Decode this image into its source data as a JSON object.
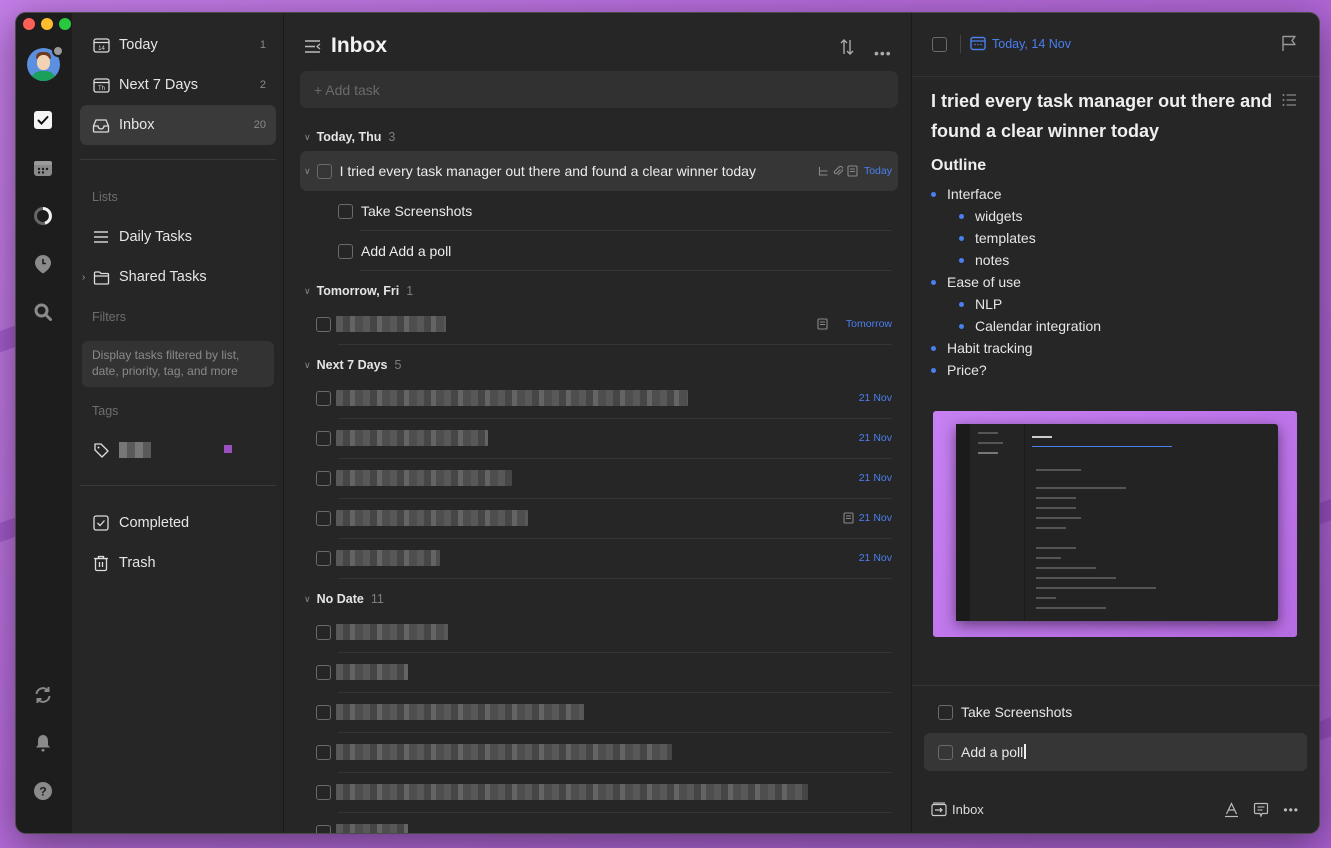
{
  "window": {
    "traffic_lights": [
      "close",
      "minimize",
      "zoom"
    ]
  },
  "rail": {
    "items": [
      {
        "name": "avatar",
        "icon": "user-avatar"
      },
      {
        "name": "tasks",
        "icon": "checkbox-icon",
        "active": true
      },
      {
        "name": "calendar",
        "icon": "calendar-icon"
      },
      {
        "name": "habit",
        "icon": "progress-ring-icon"
      },
      {
        "name": "pomodoro",
        "icon": "clock-pin-icon"
      },
      {
        "name": "search",
        "icon": "search-icon"
      },
      {
        "name": "sync",
        "icon": "sync-icon"
      },
      {
        "name": "notifications",
        "icon": "bell-icon"
      },
      {
        "name": "help",
        "icon": "help-icon"
      }
    ]
  },
  "sidebar": {
    "smart_lists": [
      {
        "label": "Today",
        "count": "1",
        "icon": "calendar-14-icon"
      },
      {
        "label": "Next 7 Days",
        "count": "2",
        "icon": "calendar-week-icon"
      },
      {
        "label": "Inbox",
        "count": "20",
        "icon": "inbox-icon",
        "active": true
      }
    ],
    "lists_header": "Lists",
    "lists": [
      {
        "label": "Daily Tasks",
        "icon": "list-icon"
      },
      {
        "label": "Shared Tasks",
        "icon": "folder-icon",
        "expandable": true
      }
    ],
    "filters_header": "Filters",
    "filters_hint": "Display tasks filtered by list, date, priority, tag, and more",
    "tags_header": "Tags",
    "tags": [
      {
        "label": "[redacted]",
        "color": "#9b4fc0"
      }
    ],
    "bottom": [
      {
        "label": "Completed",
        "icon": "completed-icon"
      },
      {
        "label": "Trash",
        "icon": "trash-icon"
      }
    ]
  },
  "main": {
    "title": "Inbox",
    "add_task_placeholder": "+ Add task",
    "groups": [
      {
        "label": "Today, Thu",
        "count": "3",
        "tasks": [
          {
            "title": "I tried every task manager out there and found a clear winner today",
            "date": "Today",
            "selected": true,
            "has_subtasks": true,
            "has_attachment": true,
            "has_note": true
          },
          {
            "title": "Take Screenshots",
            "subtask": true
          },
          {
            "title": "Add Add a poll",
            "subtask": true
          }
        ]
      },
      {
        "label": "Tomorrow, Fri",
        "count": "1",
        "tasks": [
          {
            "title": "[redacted]",
            "date": "Tomorrow",
            "has_note": true
          }
        ]
      },
      {
        "label": "Next 7 Days",
        "count": "5",
        "tasks": [
          {
            "title": "[redacted]",
            "date": "21 Nov"
          },
          {
            "title": "[redacted]",
            "date": "21 Nov"
          },
          {
            "title": "[redacted]",
            "date": "21 Nov"
          },
          {
            "title": "[redacted]",
            "date": "21 Nov",
            "has_note": true
          },
          {
            "title": "[redacted]",
            "date": "21 Nov"
          }
        ]
      },
      {
        "label": "No Date",
        "count": "11",
        "tasks": [
          {
            "title": "[redacted]"
          },
          {
            "title": "[redacted]"
          },
          {
            "title": "[redacted]"
          },
          {
            "title": "[redacted]"
          },
          {
            "title": "[redacted]"
          },
          {
            "title": "[redacted]"
          }
        ]
      }
    ]
  },
  "detail": {
    "date_label": "Today, 14 Nov",
    "title": "I tried every task manager out there and found a clear winner today",
    "outline_heading": "Outline",
    "outline": [
      {
        "text": "Interface",
        "level": 1
      },
      {
        "text": "widgets",
        "level": 2
      },
      {
        "text": "templates",
        "level": 2
      },
      {
        "text": "notes",
        "level": 2
      },
      {
        "text": "Ease of use",
        "level": 1
      },
      {
        "text": "NLP",
        "level": 2
      },
      {
        "text": "Calendar integration",
        "level": 2
      },
      {
        "text": "Habit tracking",
        "level": 1
      },
      {
        "text": "Price?",
        "level": 1
      }
    ],
    "embedded_image": "screenshot-of-app-inbox",
    "subtasks": [
      {
        "text": "Take Screenshots",
        "editing": false
      },
      {
        "text": "Add a poll",
        "editing": true
      }
    ],
    "footer_list": "Inbox"
  },
  "colors": {
    "accent": "#4a7ff0",
    "background": "#262626",
    "rail": "#1d1d1d",
    "wallpaper": "#b86ce4"
  }
}
